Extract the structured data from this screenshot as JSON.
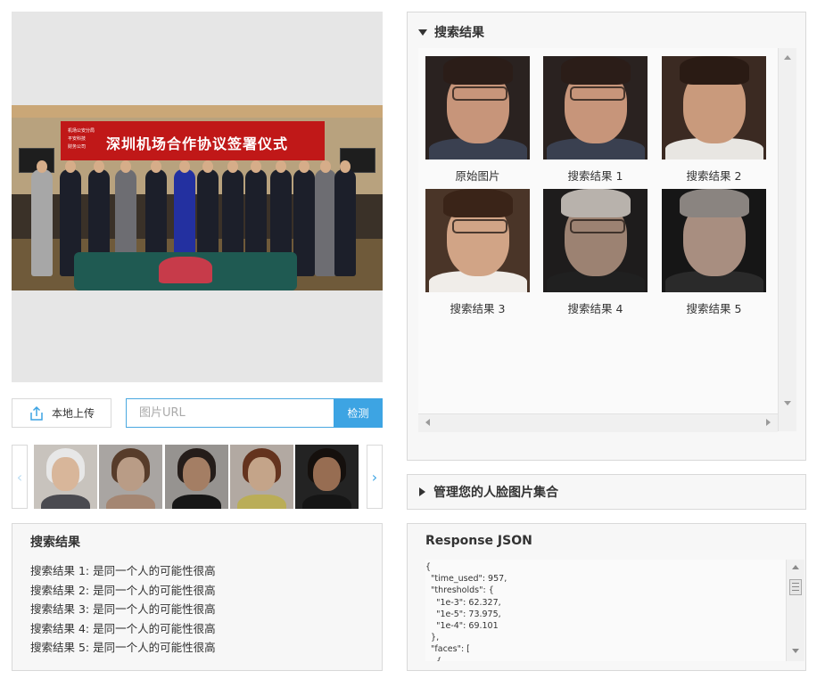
{
  "preview": {
    "banner_text": "深圳机场合作协议签署仪式",
    "banner_small": "机场公安分局\n平安科技\n财务公司"
  },
  "upload": {
    "button_label": "本地上传",
    "url_placeholder": "图片URL",
    "detect_label": "检测"
  },
  "strip": {
    "prev_icon": "chevron-left-icon",
    "next_icon": "chevron-right-icon",
    "thumbs": [
      {
        "name": "thumb-elderly-man",
        "bg": "#c8c3bd",
        "hair": "#e7e7e7",
        "face": "#d8b69a",
        "body": "#4a4a50"
      },
      {
        "name": "thumb-woman-1",
        "bg": "#cfcac6",
        "hair": "#6b4a34",
        "face": "#e2bfa4",
        "body": "#c9a48c"
      },
      {
        "name": "thumb-man-beard",
        "bg": "#b8b4b0",
        "hair": "#2e2420",
        "face": "#c99a7a",
        "body": "#1c1c1c"
      },
      {
        "name": "thumb-woman-smiling",
        "bg": "#d9cfc6",
        "hair": "#7a3f25",
        "face": "#efc8a8",
        "body": "#e3d36b"
      },
      {
        "name": "thumb-woman-dark",
        "bg": "#2b2b2b",
        "hair": "#1a1410",
        "face": "#b98565",
        "body": "#1a1a1a"
      }
    ]
  },
  "left_results": {
    "title": "搜索结果",
    "lines": [
      "搜索结果 1: 是同一个人的可能性很高",
      "搜索结果 2: 是同一个人的可能性很高",
      "搜索结果 3: 是同一个人的可能性很高",
      "搜索结果 4: 是同一个人的可能性很高",
      "搜索结果 5: 是同一个人的可能性很高"
    ]
  },
  "search_panel": {
    "title": "搜索结果",
    "faces": [
      {
        "caption": "原始图片",
        "bg": "#2a2220",
        "skin": "#c7957a",
        "hair": "#2b1d18",
        "shirt": "#3a4050",
        "glasses": true
      },
      {
        "caption": "搜索结果 1",
        "bg": "#2a2220",
        "skin": "#c7957a",
        "hair": "#2b1d18",
        "shirt": "#3a4050",
        "glasses": true
      },
      {
        "caption": "搜索结果 2",
        "bg": "#3b2a22",
        "skin": "#c99a7c",
        "hair": "#2a1b14",
        "shirt": "#e8e6e2",
        "glasses": false
      },
      {
        "caption": "搜索结果 3",
        "bg": "#4a3528",
        "skin": "#d1a486",
        "hair": "#3a2418",
        "shirt": "#f0ede9",
        "glasses": true
      },
      {
        "caption": "搜索结果 4",
        "bg": "#1e1c1c",
        "skin": "#9c8272",
        "hair": "#b8b2ac",
        "shirt": "#202020",
        "glasses": true
      },
      {
        "caption": "搜索结果 5",
        "bg": "#161616",
        "skin": "#a88e80",
        "hair": "#8a8480",
        "shirt": "#2a2a2a",
        "glasses": false
      }
    ]
  },
  "manage_panel": {
    "title": "管理您的人脸图片集合"
  },
  "json_panel": {
    "title": "Response JSON",
    "content": "{\n  \"time_used\": 957,\n  \"thresholds\": {\n    \"1e-3\": 62.327,\n    \"1e-5\": 73.975,\n    \"1e-4\": 69.101\n  },\n  \"faces\": [\n    {"
  },
  "colors": {
    "accent": "#3da4e3",
    "panel_bg": "#f7f7f7",
    "border": "#d9d9d9"
  }
}
